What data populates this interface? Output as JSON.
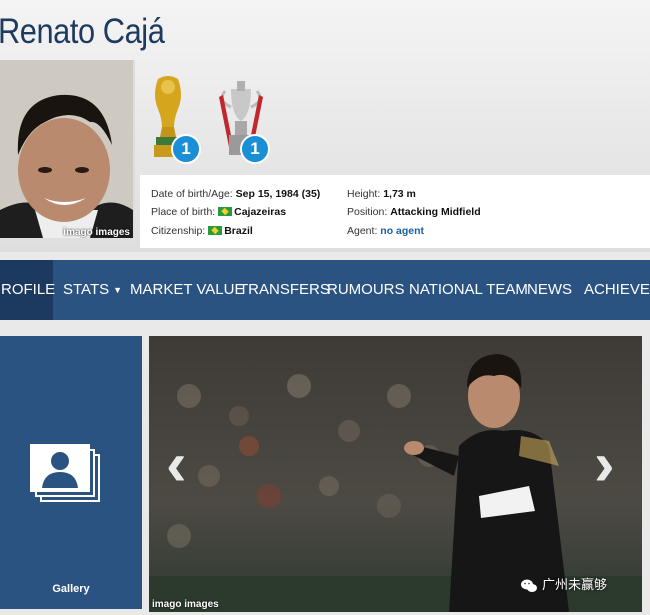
{
  "player": {
    "name": "Renato Cajá",
    "photo_credit": "imago images"
  },
  "trophies": [
    {
      "icon": "world-cup-trophy-icon",
      "count": "1"
    },
    {
      "icon": "cup-trophy-icon",
      "count": "1"
    }
  ],
  "info": {
    "dob_label": "Date of birth/Age:",
    "dob_value": "Sep 15, 1984 (35)",
    "pob_label": "Place of birth:",
    "pob_value": "Cajazeiras",
    "citizenship_label": "Citizenship:",
    "citizenship_value": "Brazil",
    "height_label": "Height:",
    "height_value": "1,73 m",
    "position_label": "Position:",
    "position_value": "Attacking Midfield",
    "agent_label": "Agent:",
    "agent_value": "no agent"
  },
  "nav": {
    "items": [
      {
        "label": "ROFILE",
        "active": true
      },
      {
        "label": "STATS",
        "dropdown": true
      },
      {
        "label": "MARKET VALUE"
      },
      {
        "label": "TRANSFERS"
      },
      {
        "label": "RUMOURS"
      },
      {
        "label": "NATIONAL TEAM"
      },
      {
        "label": "NEWS"
      },
      {
        "label": "ACHIEVEME"
      }
    ]
  },
  "gallery": {
    "label": "Gallery",
    "image_credit": "imago images",
    "prev_arrow": "‹",
    "next_arrow": "›"
  },
  "wechat_watermark": "广州未赢够",
  "colors": {
    "nav_bg": "#2b5381",
    "nav_active": "#1c3a60",
    "badge": "#1b8fd6",
    "name_text": "#1d3a5f"
  }
}
